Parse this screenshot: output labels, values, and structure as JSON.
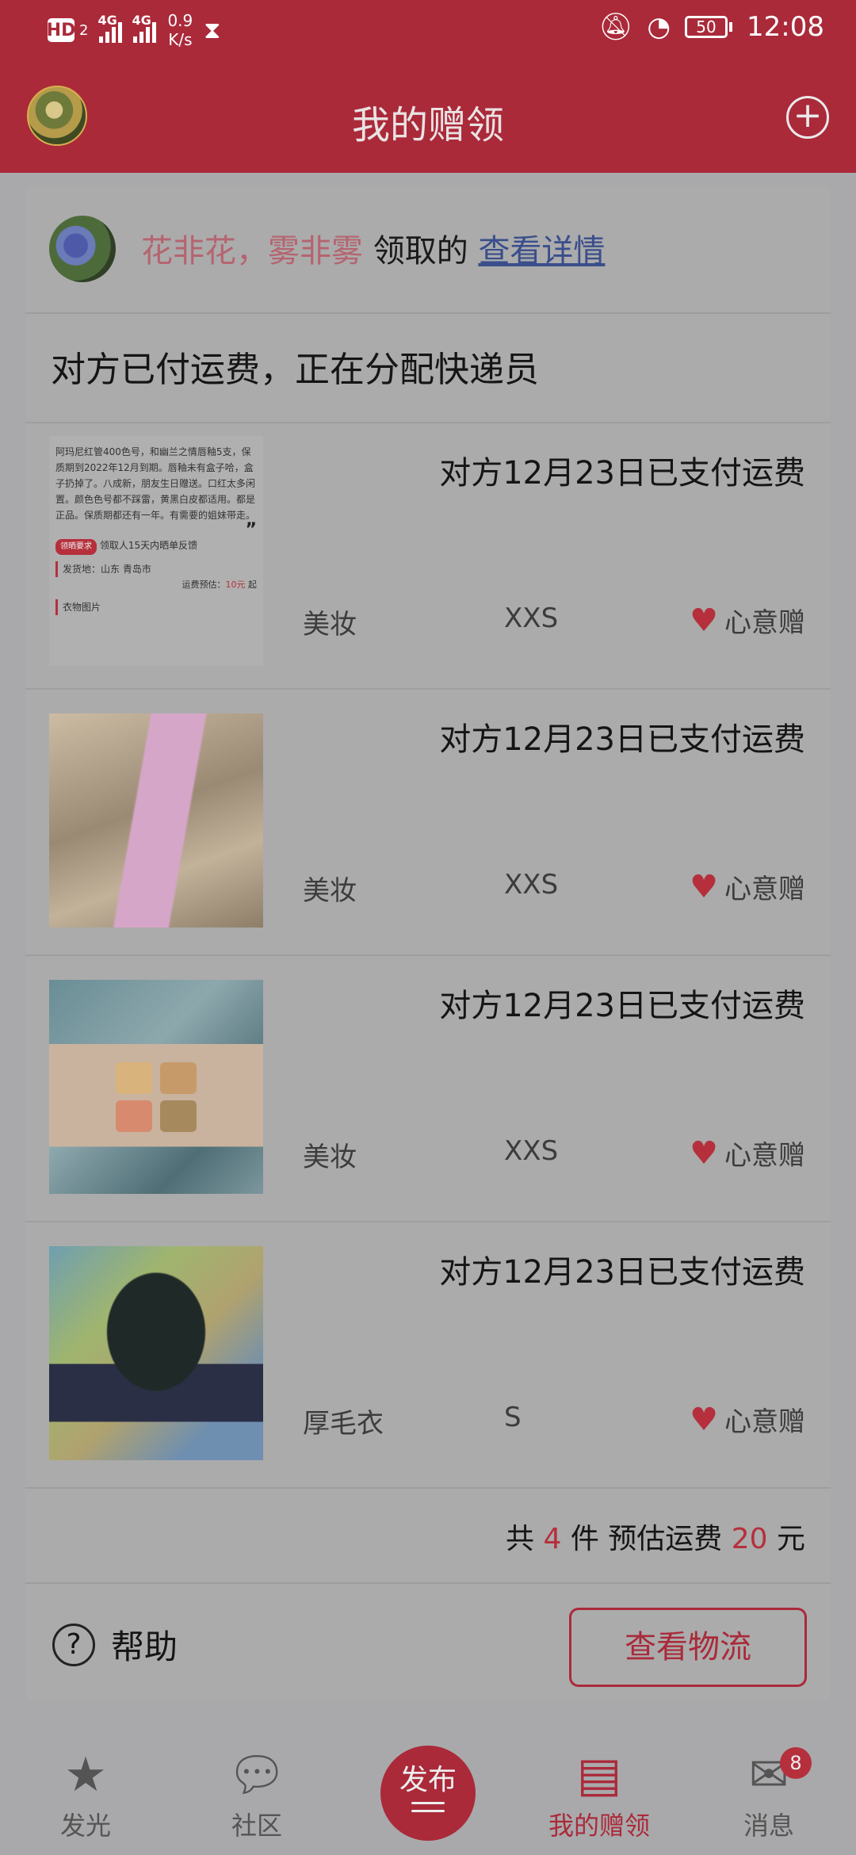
{
  "status_bar": {
    "hd": "HD",
    "hd_sub": "2",
    "network_1": "4G",
    "network_2": "4G",
    "speed_value": "0.9",
    "speed_unit": "K/s",
    "battery": "50",
    "time": "12:08"
  },
  "header": {
    "title": "我的赠领"
  },
  "claim": {
    "name": "花非花，雾非雾",
    "verb": " 领取的 ",
    "link": "查看详情",
    "status": "对方已付运费，正在分配快递员"
  },
  "thumb_text": {
    "body": "阿玛尼红管400色号，和幽兰之情唇釉5支，保质期到2022年12月到期。唇釉未有盒子哈，盒子扔掉了。八成新，朋友生日赠送。口红太多闲置。颜色色号都不踩雷，黄黑白皮都适用。都是正品。保质期都还有一年。有需要的姐妹带走。",
    "quote": "”",
    "tag": "领晒要求",
    "tag_note": "领取人15天内晒单反馈",
    "ship_from": "发货地：山东 青岛市",
    "fee_label": "运费预估：",
    "fee_value": "10元",
    "fee_suffix": "起",
    "photos_label": "衣物图片"
  },
  "items": [
    {
      "paid": "对方12月23日已支付运费",
      "category": "美妆",
      "size": "XXS",
      "type": "心意赠"
    },
    {
      "paid": "对方12月23日已支付运费",
      "category": "美妆",
      "size": "XXS",
      "type": "心意赠"
    },
    {
      "paid": "对方12月23日已支付运费",
      "category": "美妆",
      "size": "XXS",
      "type": "心意赠"
    },
    {
      "paid": "对方12月23日已支付运费",
      "category": "厚毛衣",
      "size": "S",
      "type": "心意赠"
    }
  ],
  "summary": {
    "prefix": "共 ",
    "count": "4",
    "middle": " 件 预估运费 ",
    "fee": "20",
    "suffix": " 元"
  },
  "footer": {
    "help": "帮助",
    "logistics": "查看物流"
  },
  "nav": {
    "items": [
      {
        "label": "发光"
      },
      {
        "label": "社区"
      },
      {
        "label": "发布"
      },
      {
        "label": "我的赠领"
      },
      {
        "label": "消息"
      }
    ],
    "message_badge": "8"
  },
  "colors": {
    "accent": "#aa2a3a",
    "background": "#a9a9ab"
  }
}
